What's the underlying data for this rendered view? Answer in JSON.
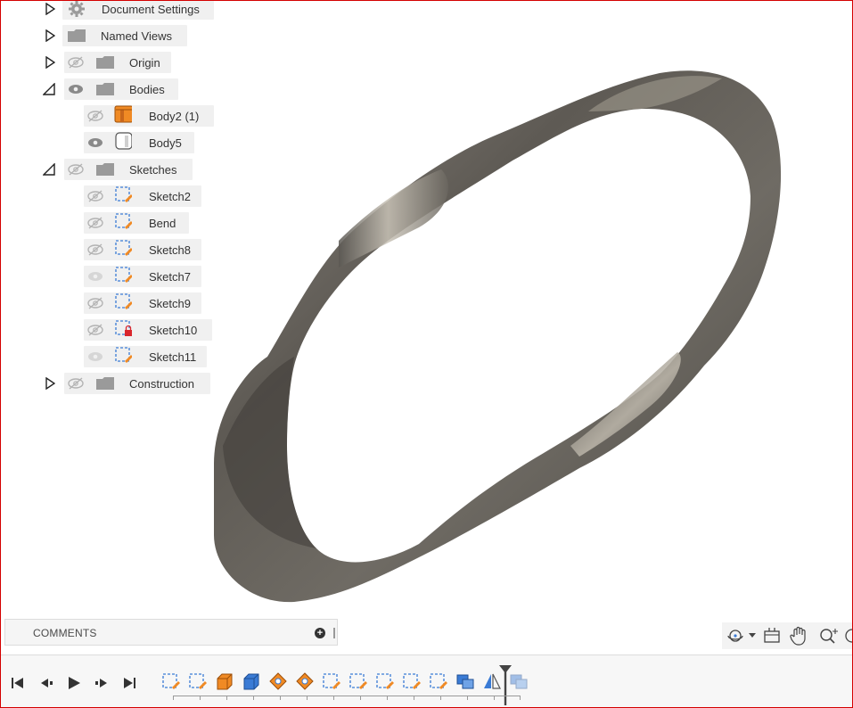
{
  "browser": {
    "items": [
      {
        "label": "Document Settings",
        "icon": "gear-icon",
        "expander": "collapsed"
      },
      {
        "label": "Named Views",
        "icon": "folder-icon",
        "expander": "collapsed"
      },
      {
        "label": "Origin",
        "icon": "folder-icon",
        "expander": "collapsed",
        "visibility": "hidden"
      },
      {
        "label": "Bodies",
        "icon": "folder-icon",
        "expander": "expanded",
        "visibility": "visible"
      },
      {
        "label": "Body2 (1)",
        "icon": "body-icon",
        "visibility": "hidden"
      },
      {
        "label": "Body5",
        "icon": "body-icon",
        "visibility": "visible"
      },
      {
        "label": "Sketches",
        "icon": "folder-icon",
        "expander": "expanded",
        "visibility": "hidden"
      },
      {
        "label": "Sketch2",
        "icon": "sketch-icon",
        "visibility": "hidden"
      },
      {
        "label": "Bend",
        "icon": "sketch-icon",
        "visibility": "hidden"
      },
      {
        "label": "Sketch8",
        "icon": "sketch-icon",
        "visibility": "hidden"
      },
      {
        "label": "Sketch7",
        "icon": "sketch-icon",
        "visibility": "dimmed"
      },
      {
        "label": "Sketch9",
        "icon": "sketch-icon",
        "visibility": "hidden"
      },
      {
        "label": "Sketch10",
        "icon": "sketch-locked-icon",
        "visibility": "hidden"
      },
      {
        "label": "Sketch11",
        "icon": "sketch-icon",
        "visibility": "dimmed"
      },
      {
        "label": "Construction",
        "icon": "folder-icon",
        "expander": "collapsed",
        "visibility": "hidden"
      }
    ]
  },
  "comments": {
    "title": "COMMENTS"
  },
  "colors": {
    "accent": "#f08a24",
    "sketch_blue": "#3a7bd5",
    "model_gray": "#6e6a62",
    "frame_red": "#d40000"
  }
}
